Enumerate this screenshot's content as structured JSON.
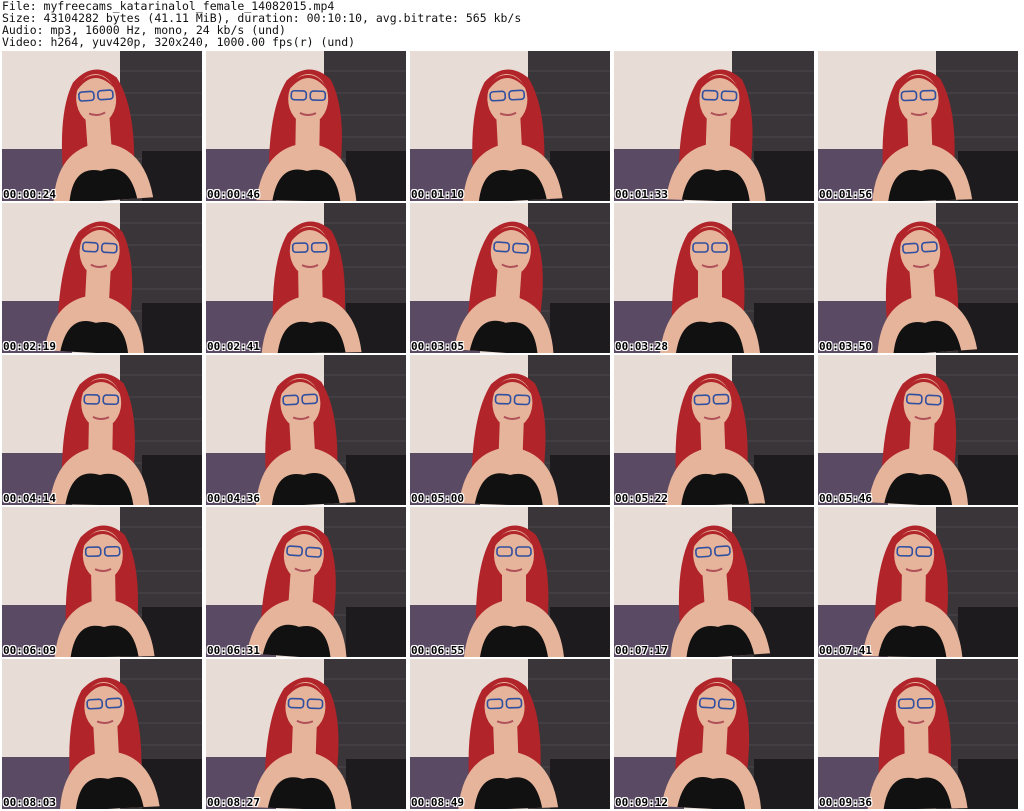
{
  "header": {
    "file_line": "File: myfreecams_katarinalol_female_14082015.mp4",
    "size_line": "Size: 43104282 bytes (41.11 MiB), duration: 00:10:10, avg.bitrate: 565 kb/s",
    "audio_line": "Audio: mp3, 16000 Hz, mono, 24 kb/s (und)",
    "video_line": "Video: h264, yuv420p, 320x240, 1000.00 fps(r) (und)"
  },
  "colors": {
    "wall_light": "#e8dcd6",
    "wall_dark": "#3a3538",
    "hair": "#b0242a",
    "skin": "#e6b49a",
    "top": "#111111",
    "pillow": "#5b4a63"
  },
  "thumbnails": [
    {
      "timestamp": "00:00:24"
    },
    {
      "timestamp": "00:00:46"
    },
    {
      "timestamp": "00:01:10"
    },
    {
      "timestamp": "00:01:33"
    },
    {
      "timestamp": "00:01:56"
    },
    {
      "timestamp": "00:02:19"
    },
    {
      "timestamp": "00:02:41"
    },
    {
      "timestamp": "00:03:05"
    },
    {
      "timestamp": "00:03:28"
    },
    {
      "timestamp": "00:03:50"
    },
    {
      "timestamp": "00:04:14"
    },
    {
      "timestamp": "00:04:36"
    },
    {
      "timestamp": "00:05:00"
    },
    {
      "timestamp": "00:05:22"
    },
    {
      "timestamp": "00:05:46"
    },
    {
      "timestamp": "00:06:09"
    },
    {
      "timestamp": "00:06:31"
    },
    {
      "timestamp": "00:06:55"
    },
    {
      "timestamp": "00:07:17"
    },
    {
      "timestamp": "00:07:41"
    },
    {
      "timestamp": "00:08:03"
    },
    {
      "timestamp": "00:08:27"
    },
    {
      "timestamp": "00:08:49"
    },
    {
      "timestamp": "00:09:12"
    },
    {
      "timestamp": "00:09:36"
    }
  ]
}
